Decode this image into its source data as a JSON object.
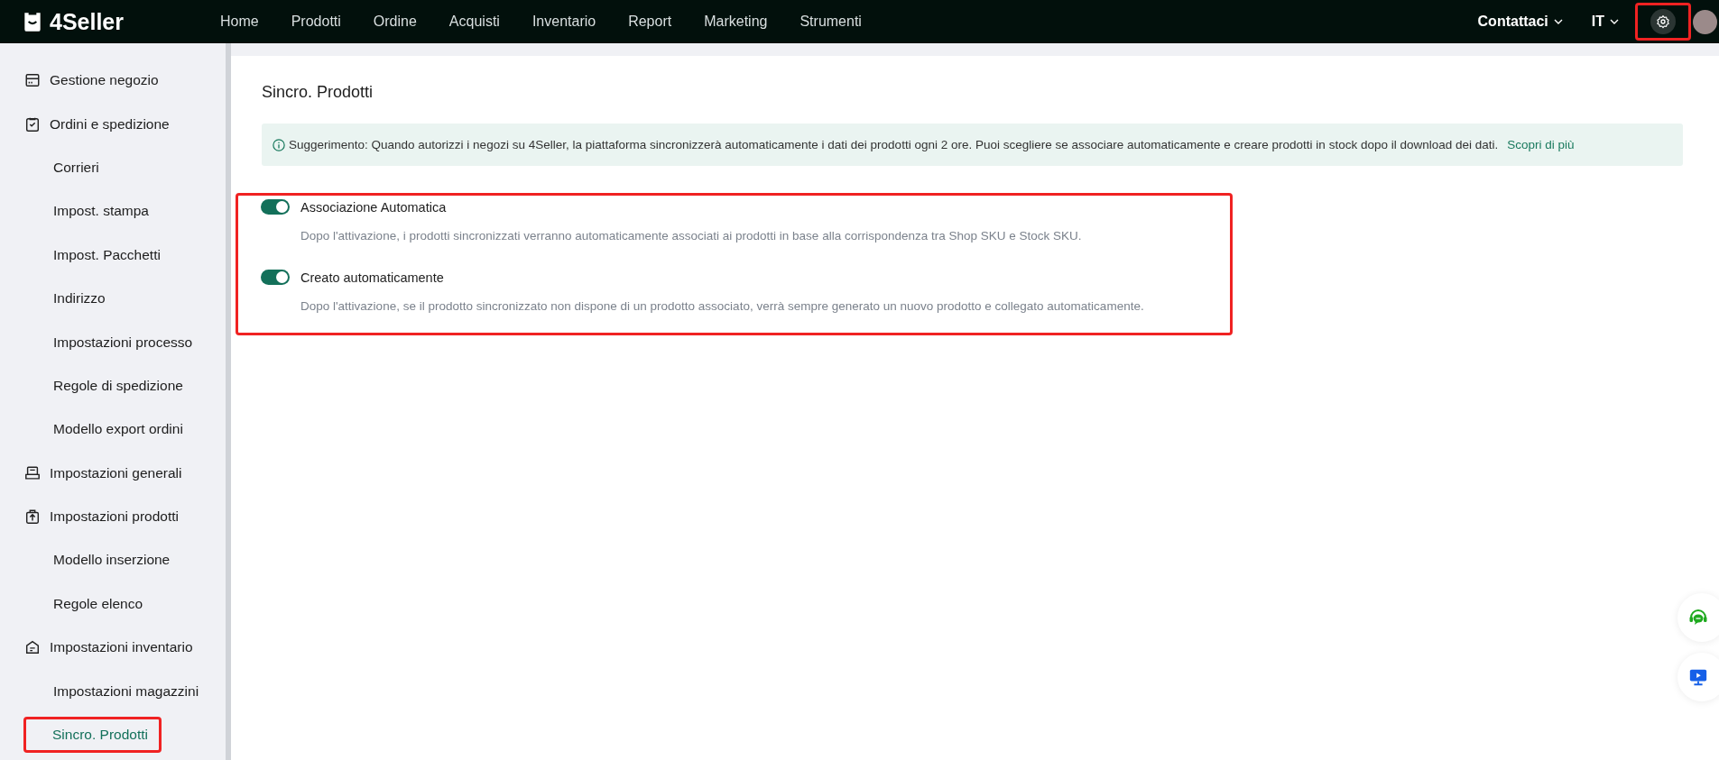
{
  "brand": {
    "name": "4Seller"
  },
  "nav": [
    {
      "label": "Home"
    },
    {
      "label": "Prodotti"
    },
    {
      "label": "Ordine"
    },
    {
      "label": "Acquisti"
    },
    {
      "label": "Inventario"
    },
    {
      "label": "Report"
    },
    {
      "label": "Marketing"
    },
    {
      "label": "Strumenti"
    }
  ],
  "header_right": {
    "contact": "Contattaci",
    "language": "IT",
    "settings_annotated": true
  },
  "sidebar": {
    "groups": [
      {
        "label": "Gestione negozio"
      },
      {
        "label": "Ordini e spedizione",
        "children": [
          {
            "label": "Corrieri",
            "selected": false,
            "annotated": false
          },
          {
            "label": "Impost. stampa",
            "selected": false,
            "annotated": false
          },
          {
            "label": "Impost. Pacchetti",
            "selected": false,
            "annotated": false
          },
          {
            "label": "Indirizzo",
            "selected": false,
            "annotated": false
          },
          {
            "label": "Impostazioni processo",
            "selected": false,
            "annotated": false
          },
          {
            "label": "Regole di spedizione",
            "selected": false,
            "annotated": false
          },
          {
            "label": "Modello export ordini",
            "selected": false,
            "annotated": false
          }
        ]
      },
      {
        "label": "Impostazioni generali"
      },
      {
        "label": "Impostazioni prodotti",
        "children": [
          {
            "label": "Modello inserzione",
            "selected": false,
            "annotated": false
          },
          {
            "label": "Regole elenco",
            "selected": false,
            "annotated": false
          }
        ]
      },
      {
        "label": "Impostazioni inventario",
        "children": [
          {
            "label": "Impostazioni magazzini",
            "selected": false,
            "annotated": false
          },
          {
            "label": "Sincro. Prodotti",
            "selected": true,
            "annotated": true
          }
        ]
      }
    ]
  },
  "page": {
    "title": "Sincro. Prodotti",
    "tip": {
      "text": "Suggerimento: Quando autorizzi i negozi su 4Seller, la piattaforma sincronizzerà automaticamente i dati dei prodotti ogni 2 ore. Puoi scegliere se associare automaticamente e creare prodotti in stock dopo il download dei dati.",
      "link": "Scopri di più"
    },
    "settings_annotated": true,
    "settings": [
      {
        "label": "Associazione Automatica",
        "description": "Dopo l'attivazione, i prodotti sincronizzati verranno automaticamente associati ai prodotti in base alla corrispondenza tra Shop SKU e Stock SKU.",
        "on": true
      },
      {
        "label": "Creato automaticamente",
        "description": "Dopo l'attivazione, se il prodotto sincronizzato non dispone di un prodotto associato, verrà sempre generato un nuovo prodotto e collegato automaticamente.",
        "on": true
      }
    ]
  }
}
